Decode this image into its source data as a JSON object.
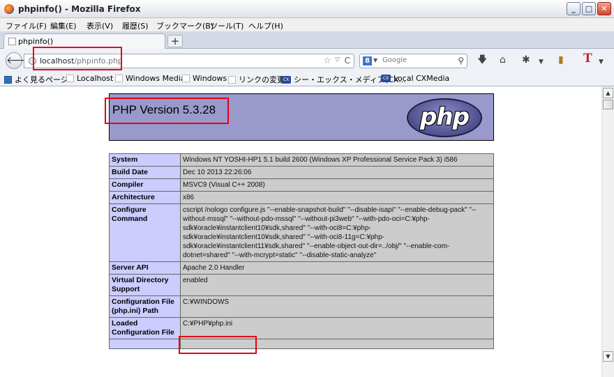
{
  "window": {
    "title": "phpinfo() - Mozilla Firefox"
  },
  "menu": [
    "ファイル(F)",
    "編集(E)",
    "表示(V)",
    "履歴(S)",
    "ブックマーク(B)",
    "ツール(T)",
    "ヘルプ(H)"
  ],
  "tab": {
    "label": "phpinfo()"
  },
  "address": {
    "host": "localhost",
    "path": "/phpinfo.php"
  },
  "search": {
    "engine": "8",
    "placeholder": "Google"
  },
  "bookmarks": [
    "よく見るページ",
    "Localhost",
    "Windows Media",
    "Windows",
    "リンクの変更",
    "シー・エックス・メディア(CX...",
    "Local CXMedia"
  ],
  "php": {
    "version": "PHP Version 5.3.28",
    "logo": "php"
  },
  "info_rows": [
    {
      "key": "System",
      "value": "Windows NT YOSHI-HP1 5.1 build 2600 (Windows XP Professional Service Pack 3) i586"
    },
    {
      "key": "Build Date",
      "value": "Dec 10 2013 22:26:06"
    },
    {
      "key": "Compiler",
      "value": "MSVC9 (Visual C++ 2008)"
    },
    {
      "key": "Architecture",
      "value": "x86"
    },
    {
      "key": "Configure Command",
      "value": "cscript /nologo configure.js \"--enable-snapshot-build\" \"--disable-isapi\" \"--enable-debug-pack\" \"--without-mssql\" \"--without-pdo-mssql\" \"--without-pi3web\" \"--with-pdo-oci=C:¥php-sdk¥oracle¥instantclient10¥sdk,shared\" \"--with-oci8=C:¥php-sdk¥oracle¥instantclient10¥sdk,shared\" \"--with-oci8-11g=C:¥php-sdk¥oracle¥instantclient11¥sdk,shared\" \"--enable-object-out-dir=../obj/\" \"--enable-com-dotnet=shared\" \"--with-mcrypt=static\" \"--disable-static-analyze\""
    },
    {
      "key": "Server API",
      "value": "Apache 2.0 Handler"
    },
    {
      "key": "Virtual Directory Support",
      "value": "enabled"
    },
    {
      "key": "Configuration File (php.ini) Path",
      "value": "C:¥WINDOWS"
    },
    {
      "key": "Loaded Configuration File",
      "value": "C:¥PHP¥php.ini"
    },
    {
      "key": "",
      "value": ""
    }
  ]
}
